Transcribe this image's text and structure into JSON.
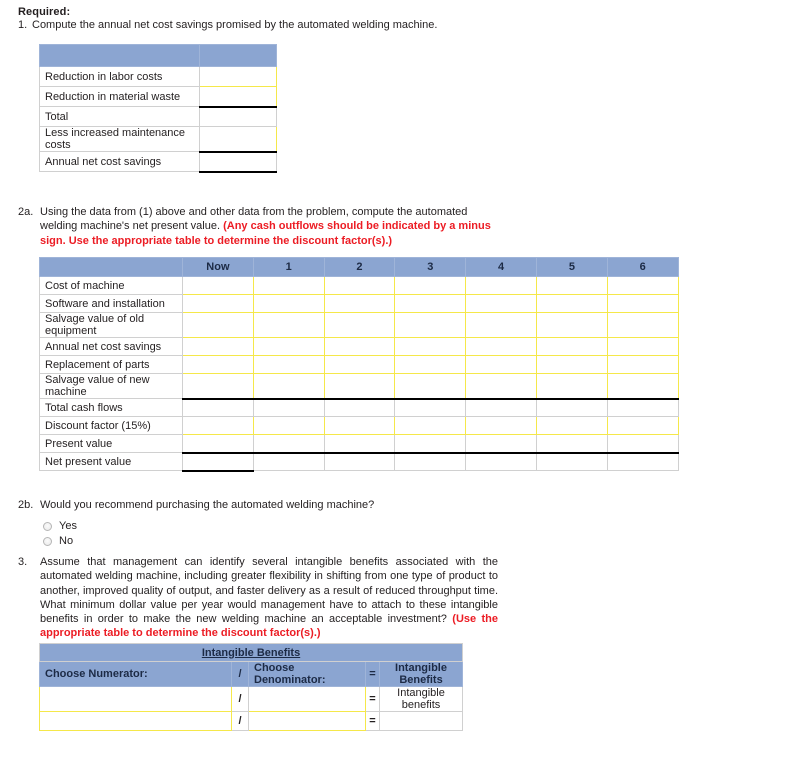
{
  "page": {
    "required_heading": "Required:",
    "accent_blue": "#8ba5d1",
    "accent_red": "#ec1c24",
    "input_border": "#f5e84a"
  },
  "q1": {
    "number": "1.",
    "text": "Compute the annual net cost savings promised by the automated welding machine."
  },
  "table1": {
    "header_label": "",
    "header_value": "",
    "rows": [
      {
        "label": "Reduction in labor costs",
        "kind": "input"
      },
      {
        "label": "Reduction in material waste",
        "kind": "input"
      },
      {
        "label": "Total",
        "kind": "plain"
      },
      {
        "label": "Less increased maintenance costs",
        "kind": "input"
      },
      {
        "label": "Annual net cost savings",
        "kind": "total"
      }
    ]
  },
  "q2a": {
    "number": "2a.",
    "text": "Using the data from (1) above and other data from the problem, compute the automated welding machine's net present value. ",
    "emphasis": "(Any cash outflows should be indicated by a minus sign. Use the appropriate table to determine the discount factor(s).)"
  },
  "table2": {
    "columns": [
      "",
      "Now",
      "1",
      "2",
      "3",
      "4",
      "5",
      "6"
    ],
    "rows": [
      {
        "label": "Cost of machine",
        "kind": "input"
      },
      {
        "label": "Software and installation",
        "kind": "input"
      },
      {
        "label": "Salvage value of old equipment",
        "kind": "input"
      },
      {
        "label": "Annual net cost savings",
        "kind": "input"
      },
      {
        "label": "Replacement of parts",
        "kind": "input"
      },
      {
        "label": "Salvage value of new machine",
        "kind": "input"
      },
      {
        "label": "Total cash flows",
        "kind": "subtotal"
      },
      {
        "label": "Discount factor (15%)",
        "kind": "input"
      },
      {
        "label": "Present value",
        "kind": "plain"
      },
      {
        "label": "Net present value",
        "kind": "total"
      }
    ]
  },
  "q2b": {
    "number": "2b.",
    "text": "Would you recommend purchasing the automated welding machine?",
    "options": [
      {
        "label": "Yes",
        "selected": false
      },
      {
        "label": "No",
        "selected": false
      }
    ]
  },
  "q3": {
    "number": "3.",
    "text": "Assume that management can identify several intangible benefits associated with the automated welding machine, including greater flexibility in shifting from one type of product to another, improved quality of output, and faster delivery as a result of reduced throughput time. What minimum dollar value per year would management have to attach to these intangible benefits in order to make the new welding machine an acceptable investment? ",
    "emphasis": "(Use the appropriate table to determine the discount factor(s).)"
  },
  "table3": {
    "title": "Intangible Benefits",
    "headers": {
      "numerator": "Choose Numerator:",
      "slash": "/",
      "denominator": "Choose Denominator:",
      "equals": "=",
      "result": "Intangible Benefits"
    },
    "rows": [
      {
        "numerator": "",
        "slash": "/",
        "denominator": "",
        "equals": "=",
        "result": "Intangible benefits"
      },
      {
        "numerator": "",
        "slash": "/",
        "denominator": "",
        "equals": "=",
        "result": ""
      }
    ]
  }
}
